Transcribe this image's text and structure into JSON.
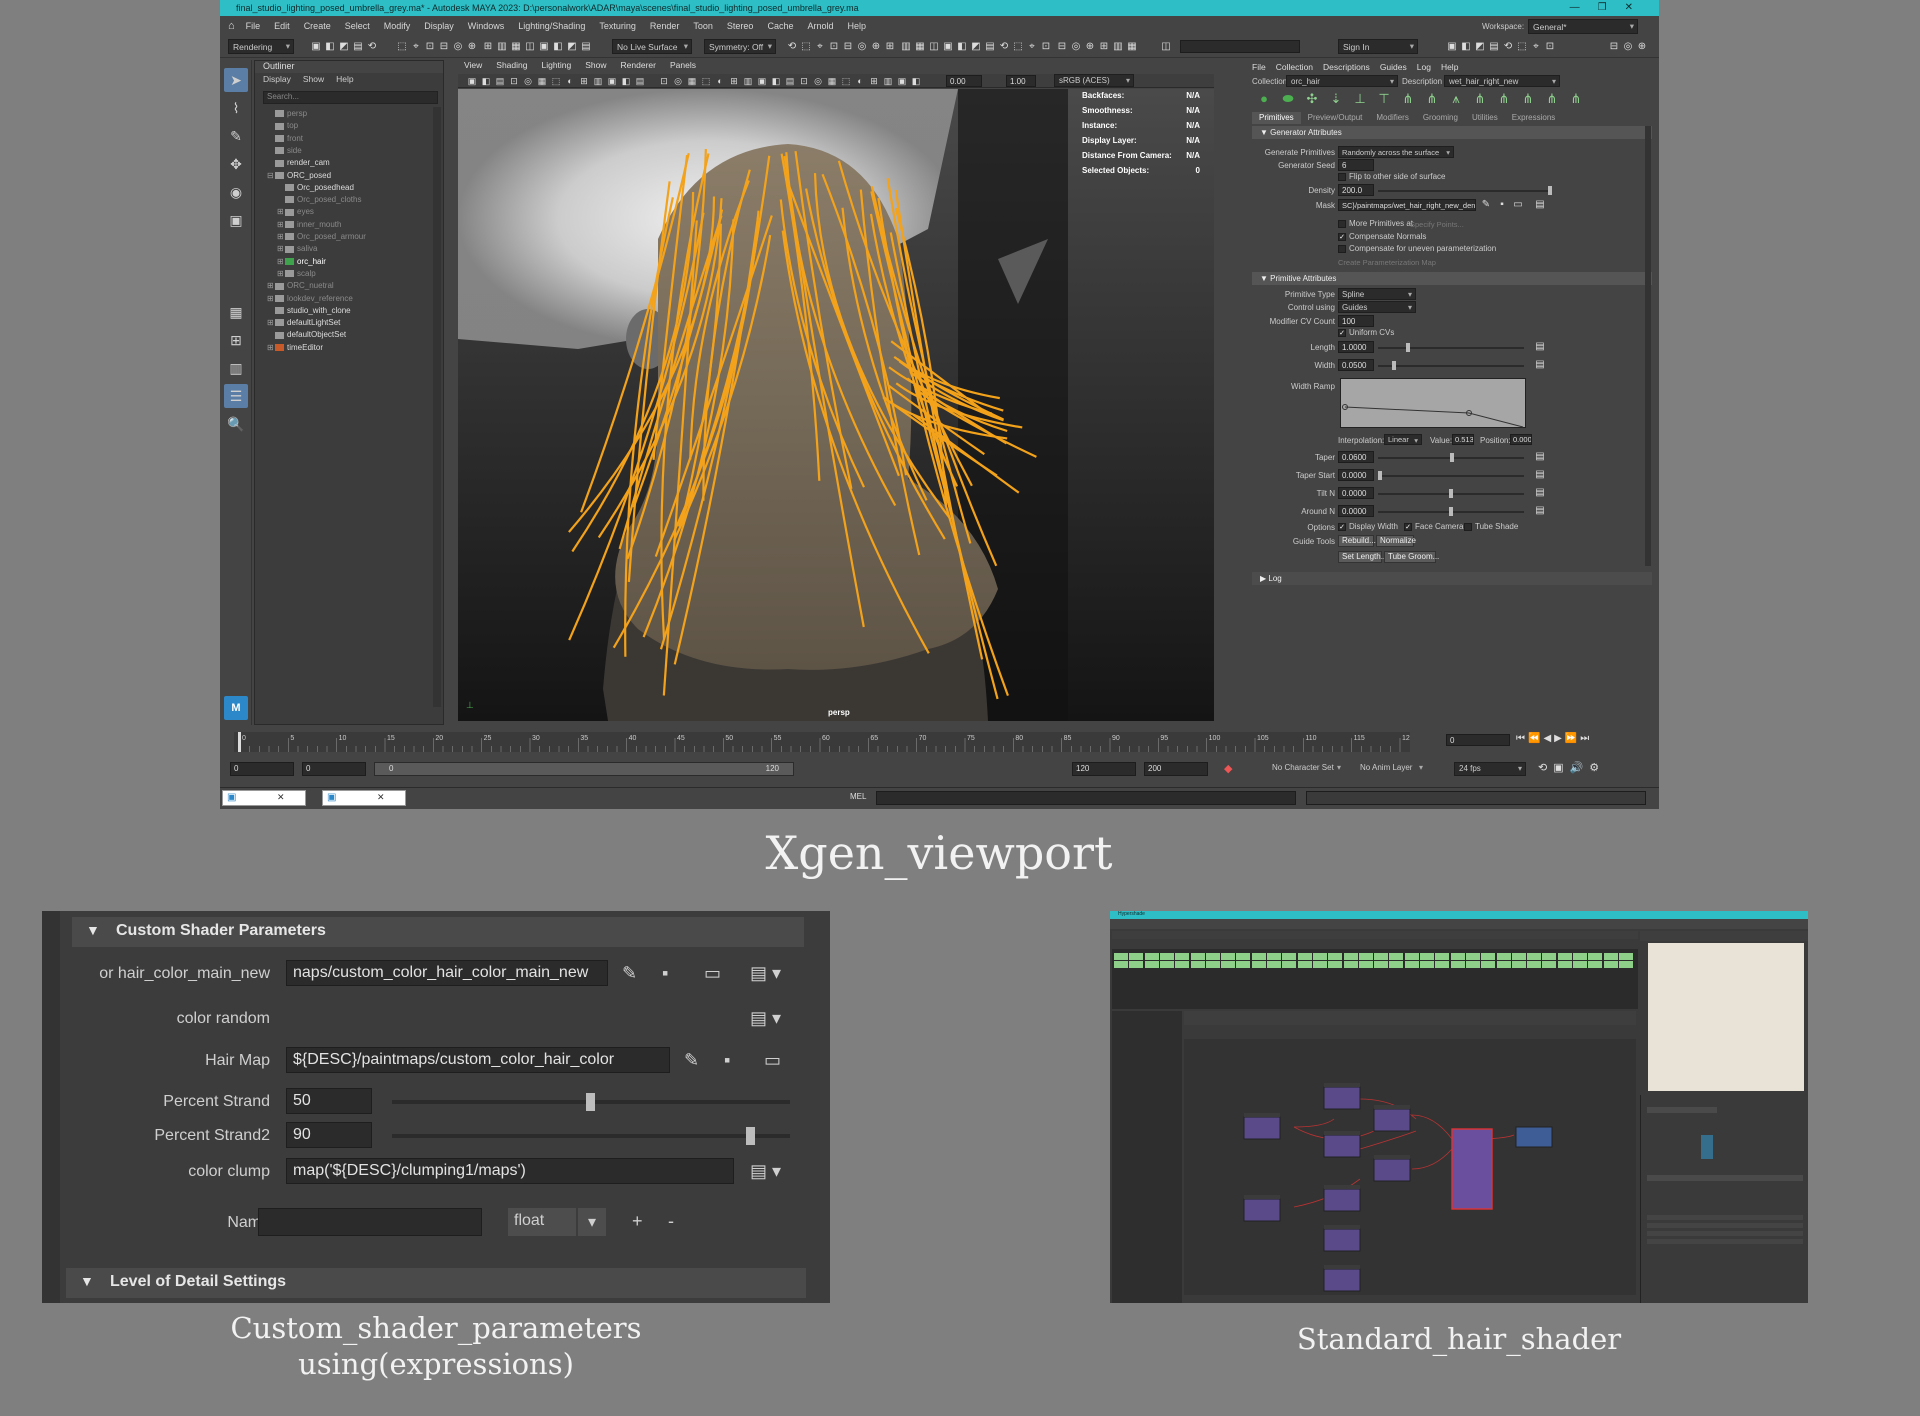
{
  "maya": {
    "title": "final_studio_lighting_posed_umbrella_grey.ma* - Autodesk MAYA 2023: D:\\personalwork\\ADAR\\maya\\scenes\\final_studio_lighting_posed_umbrella_grey.ma",
    "menu": [
      "File",
      "Edit",
      "Create",
      "Select",
      "Modify",
      "Display",
      "Windows",
      "Lighting/Shading",
      "Texturing",
      "Render",
      "Toon",
      "Stereo",
      "Cache",
      "Arnold",
      "Help"
    ],
    "workspace_label": "Workspace:",
    "workspace_value": "General*",
    "menuset": "Rendering",
    "live_surface": "No Live Surface",
    "symmetry": "Symmetry: Off",
    "sign_in": "Sign In",
    "outliner": {
      "title": "Outliner",
      "menu": [
        "Display",
        "Show",
        "Help"
      ],
      "search_placeholder": "Search...",
      "items": [
        {
          "label": "persp",
          "dim": true,
          "indent": 0,
          "exp": ""
        },
        {
          "label": "top",
          "dim": true,
          "indent": 0,
          "exp": ""
        },
        {
          "label": "front",
          "dim": true,
          "indent": 0,
          "exp": ""
        },
        {
          "label": "side",
          "dim": true,
          "indent": 0,
          "exp": ""
        },
        {
          "label": "render_cam",
          "dim": false,
          "indent": 0,
          "exp": ""
        },
        {
          "label": "ORC_posed",
          "dim": false,
          "indent": 0,
          "exp": "⊟"
        },
        {
          "label": "Orc_posedhead",
          "dim": false,
          "indent": 1,
          "exp": ""
        },
        {
          "label": "Orc_posed_cloths",
          "dim": true,
          "indent": 1,
          "exp": ""
        },
        {
          "label": "eyes",
          "dim": true,
          "indent": 1,
          "exp": "⊞"
        },
        {
          "label": "inner_mouth",
          "dim": true,
          "indent": 1,
          "exp": "⊞"
        },
        {
          "label": "Orc_posed_armour",
          "dim": true,
          "indent": 1,
          "exp": "⊞"
        },
        {
          "label": "saliva",
          "dim": true,
          "indent": 1,
          "exp": "⊞"
        },
        {
          "label": "orc_hair",
          "dim": false,
          "indent": 1,
          "exp": "⊞"
        },
        {
          "label": "scalp",
          "dim": true,
          "indent": 1,
          "exp": "⊞"
        },
        {
          "label": "ORC_nuetral",
          "dim": true,
          "indent": 0,
          "exp": "⊞"
        },
        {
          "label": "lookdev_reference",
          "dim": true,
          "indent": 0,
          "exp": "⊞"
        },
        {
          "label": "studio_with_clone",
          "dim": false,
          "indent": 0,
          "exp": ""
        },
        {
          "label": "defaultLightSet",
          "dim": false,
          "indent": 0,
          "exp": "⊞"
        },
        {
          "label": "defaultObjectSet",
          "dim": false,
          "indent": 0,
          "exp": ""
        },
        {
          "label": "timeEditor",
          "dim": false,
          "indent": 0,
          "exp": "⊞"
        }
      ]
    },
    "viewport": {
      "menu": [
        "View",
        "Shading",
        "Lighting",
        "Show",
        "Renderer",
        "Panels"
      ],
      "field_a": "0.00",
      "field_b": "1.00",
      "colorspace": "sRGB (ACES)",
      "camera_label": "persp",
      "hud": [
        {
          "k": "Backfaces:",
          "v": "N/A"
        },
        {
          "k": "Smoothness:",
          "v": "N/A"
        },
        {
          "k": "Instance:",
          "v": "N/A"
        },
        {
          "k": "Display Layer:",
          "v": "N/A"
        },
        {
          "k": "Distance From Camera:",
          "v": "N/A"
        },
        {
          "k": "Selected Objects:",
          "v": "0"
        }
      ]
    },
    "xgen": {
      "menu": [
        "File",
        "Collection",
        "Descriptions",
        "Guides",
        "Log",
        "Help"
      ],
      "collection_label": "Collection",
      "collection_value": "orc_hair",
      "description_label": "Description",
      "description_value": "wet_hair_right_new",
      "tabs": [
        "Primitives",
        "Preview/Output",
        "Modifiers",
        "Grooming",
        "Utilities",
        "Expressions"
      ],
      "generator_header": "Generator Attributes",
      "generate_primitives_label": "Generate Primitives",
      "generate_primitives_value": "Randomly across the surface",
      "generator_seed_label": "Generator Seed",
      "generator_seed_value": "6",
      "flip_label": "Flip to other side of surface",
      "density_label": "Density",
      "density_value": "200.0",
      "mask_label": "Mask",
      "mask_value": "SC}/paintmaps/wet_hair_right_new_density",
      "more_primitives_label": "More Primitives at",
      "specify_points": "Specify Points...",
      "compensate_normals": "Compensate Normals",
      "compensate_uneven": "Compensate for uneven parameterization",
      "create_param_map": "Create Parameterization Map",
      "primitive_header": "Primitive Attributes",
      "primitive_type_label": "Primitive Type",
      "primitive_type_value": "Spline",
      "control_using_label": "Control using",
      "control_using_value": "Guides",
      "modifier_cv_label": "Modifier CV Count",
      "modifier_cv_value": "100",
      "uniform_cvs": "Uniform CVs",
      "length_label": "Length",
      "length_value": "1.0000",
      "width_label": "Width",
      "width_value": "0.0500",
      "width_ramp_label": "Width Ramp",
      "interpolation_label": "Interpolation:",
      "interpolation_value": "Linear",
      "value_label": "Value:",
      "value_value": "0.513",
      "position_label": "Position:",
      "position_value": "0.000",
      "taper_label": "Taper",
      "taper_value": "0.0600",
      "taper_start_label": "Taper Start",
      "taper_start_value": "0.0000",
      "tilt_label": "Tilt N",
      "tilt_value": "0.0000",
      "around_label": "Around N",
      "around_value": "0.0000",
      "options_label": "Options",
      "display_width": "Display Width",
      "face_camera": "Face Camera",
      "tube_shade": "Tube Shade",
      "guide_tools_label": "Guide Tools",
      "rebuild": "Rebuild...",
      "normalize": "Normalize",
      "set_length": "Set Length...",
      "tube_groom": "Tube Groom...",
      "log_label": "Log"
    },
    "timeline": {
      "ticks": [
        "0",
        "5",
        "10",
        "15",
        "20",
        "25",
        "30",
        "35",
        "40",
        "45",
        "50",
        "55",
        "60",
        "65",
        "70",
        "75",
        "80",
        "85",
        "90",
        "95",
        "100",
        "105",
        "110",
        "115",
        "120"
      ],
      "current_frame": "0",
      "range_start": "0",
      "range_start2": "0",
      "range_slider_start": "0",
      "range_slider_end": "120",
      "range_end": "120",
      "range_end2": "200",
      "character_set": "No Character Set",
      "anim_layer": "No Anim Layer",
      "fps": "24 fps",
      "mel_label": "MEL"
    }
  },
  "captions": {
    "viewport": "Xgen_viewport",
    "custom_line1": "Custom_shader_parameters",
    "custom_line2": "using(expressions)",
    "hypershade": "Standard_hair_shader"
  },
  "custom_shader": {
    "header": "Custom Shader Parameters",
    "rows": {
      "hair_color_label": "or hair_color_main_new",
      "hair_color_value": "naps/custom_color_hair_color_main_new",
      "color_random_label": "color random",
      "hair_map_label": "Hair Map",
      "hair_map_value": "${DESC}/paintmaps/custom_color_hair_color",
      "percent_strand_label": "Percent Strand",
      "percent_strand_value": "50",
      "percent_strand2_label": "Percent Strand2",
      "percent_strand2_value": "90",
      "color_clump_label": "color clump",
      "color_clump_value": "map('${DESC}/clumping1/maps')",
      "name_label": "Name",
      "type_value": "float",
      "plus": "+",
      "minus": "-"
    },
    "lod_header": "Level of Detail Settings"
  },
  "hypershade": {
    "title": "Hypershade"
  }
}
